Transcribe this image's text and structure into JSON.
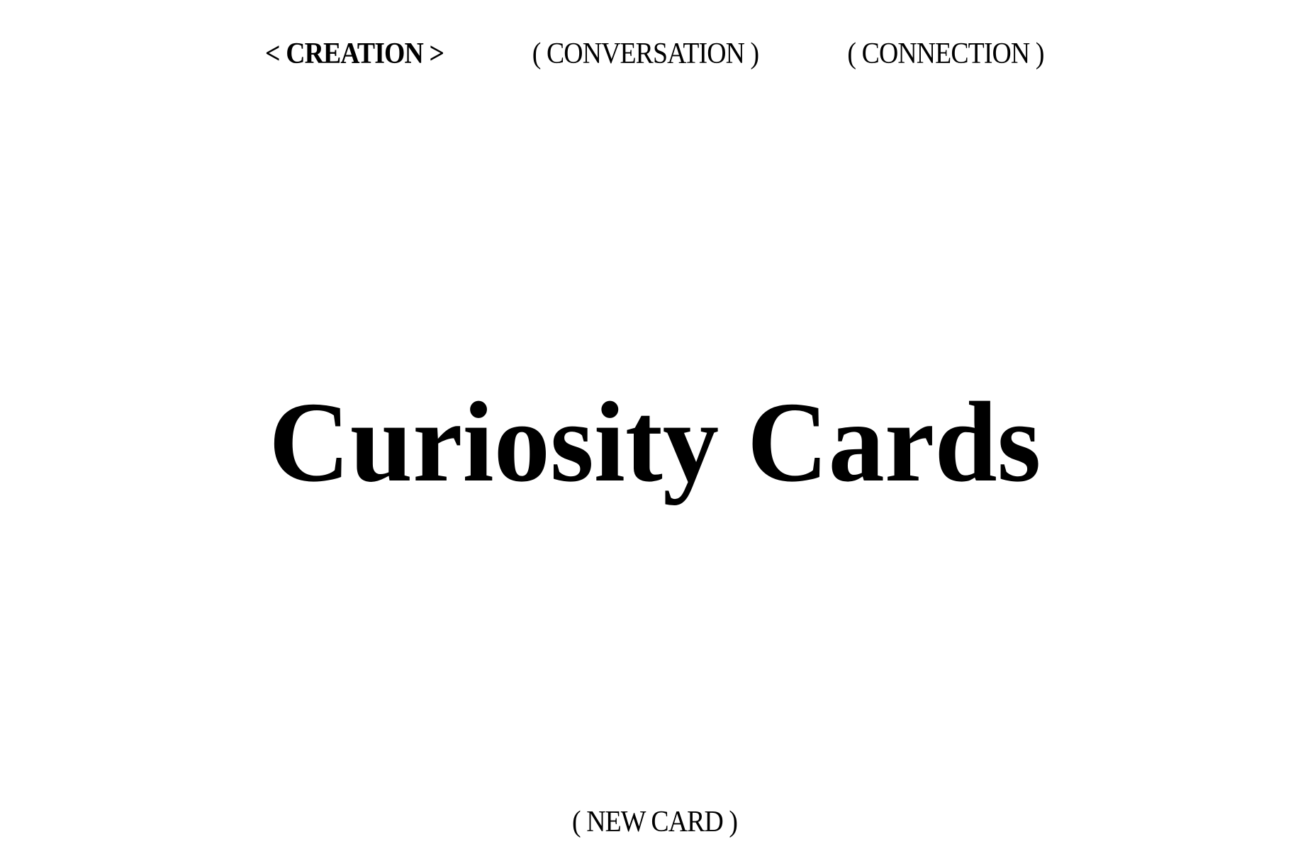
{
  "nav": {
    "items": [
      {
        "label": "< CREATION >",
        "active": true
      },
      {
        "label": "( CONVERSATION )",
        "active": false
      },
      {
        "label": "( CONNECTION )",
        "active": false
      }
    ]
  },
  "main": {
    "title": "Curiosity Cards"
  },
  "actions": {
    "new_card_label": "( NEW CARD )"
  }
}
